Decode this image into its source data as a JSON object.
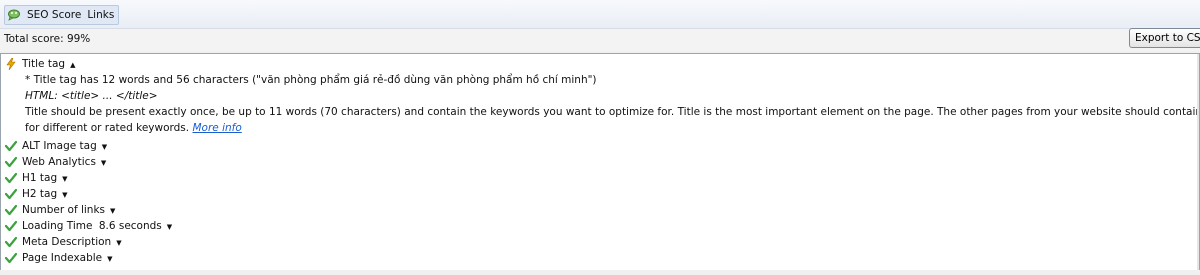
{
  "tabs": {
    "icon": "seo-plugin-icon",
    "seo_score": "SEO Score",
    "links": "Links"
  },
  "summary": {
    "total_score": "Total score: 99%",
    "export_button": "Export to CSV..."
  },
  "checks": {
    "title": {
      "label": "Title tag",
      "status": "warning",
      "expanded": true,
      "detail_line1": "* Title tag has 12 words and 56 characters (\"văn phòng phẩm giá rẻ-đồ dùng văn phòng phẩm hồ chí minh\")",
      "detail_html": "HTML: <title> ... </title>",
      "description_line1": "Title should be present exactly once, be up to 11 words (70 characters) and contain the keywords you want to optimize for. Title is the most important element on the page. The other pages from your website should contain different titles, optimized",
      "description_line2": "for different or rated keywords.",
      "more_info": "More info"
    },
    "alt": {
      "label": "ALT Image tag",
      "status": "ok"
    },
    "analytics": {
      "label": "Web Analytics",
      "status": "ok"
    },
    "h1": {
      "label": "H1 tag",
      "status": "ok"
    },
    "h2": {
      "label": "H2 tag",
      "status": "ok"
    },
    "links": {
      "label": "Number of links",
      "status": "ok"
    },
    "loading": {
      "label": "Loading Time",
      "value": "8.6 seconds",
      "status": "ok"
    },
    "meta": {
      "label": "Meta Description",
      "status": "ok"
    },
    "indexable": {
      "label": "Page Indexable",
      "status": "ok"
    }
  },
  "colors": {
    "ok_check": "#3aa33a",
    "warning": "#e8a800",
    "link": "#1a5fd1"
  }
}
